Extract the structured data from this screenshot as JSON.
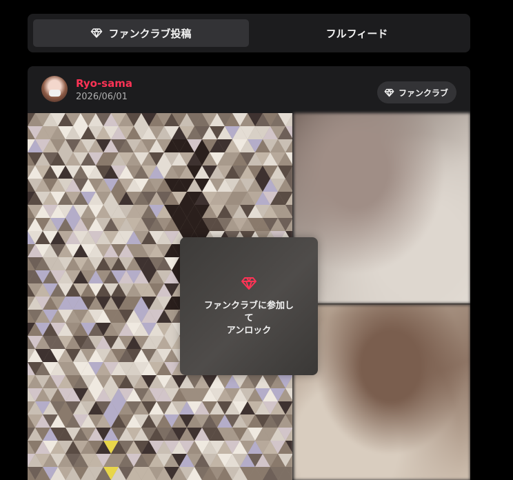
{
  "tabs": [
    {
      "label": "ファンクラブ投稿",
      "icon": "diamond-icon",
      "active": true
    },
    {
      "label": "フルフィード",
      "active": false
    }
  ],
  "post": {
    "author": {
      "name": "Ryo-sama",
      "name_color": "#ff3355"
    },
    "date": "2026/06/01",
    "badge": {
      "label": "ファンクラブ",
      "icon": "diamond-icon"
    },
    "lock": {
      "icon": "diamond-icon",
      "icon_color": "#ff3355",
      "line1": "ファンクラブに参加し",
      "line2": "て",
      "line3": "アンロック"
    }
  },
  "colors": {
    "background": "#000000",
    "card": "#1c1c1e",
    "accent": "#ff3355"
  }
}
